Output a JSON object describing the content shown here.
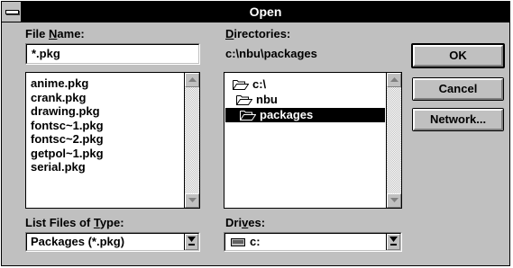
{
  "window": {
    "title": "Open"
  },
  "file_name": {
    "label_pre": "File ",
    "label_u": "N",
    "label_post": "ame:",
    "value": "*.pkg",
    "files": [
      "anime.pkg",
      "crank.pkg",
      "drawing.pkg",
      "fontsc~1.pkg",
      "fontsc~2.pkg",
      "getpol~1.pkg",
      "serial.pkg"
    ]
  },
  "directories": {
    "label_u": "D",
    "label_post": "irectories:",
    "current_path": "c:\\nbu\\packages",
    "tree": [
      {
        "label": "c:\\",
        "state": "open"
      },
      {
        "label": "nbu",
        "state": "open"
      },
      {
        "label": "packages",
        "state": "open-selected"
      }
    ]
  },
  "file_type": {
    "label_pre": "List Files of ",
    "label_u": "T",
    "label_post": "ype:",
    "selected": "Packages (*.pkg)"
  },
  "drives": {
    "label_pre": "Dri",
    "label_u": "v",
    "label_post": "es:",
    "selected": "c:",
    "icon": "drive-icon"
  },
  "buttons": {
    "ok": "OK",
    "cancel": "Cancel",
    "network": "Network..."
  }
}
